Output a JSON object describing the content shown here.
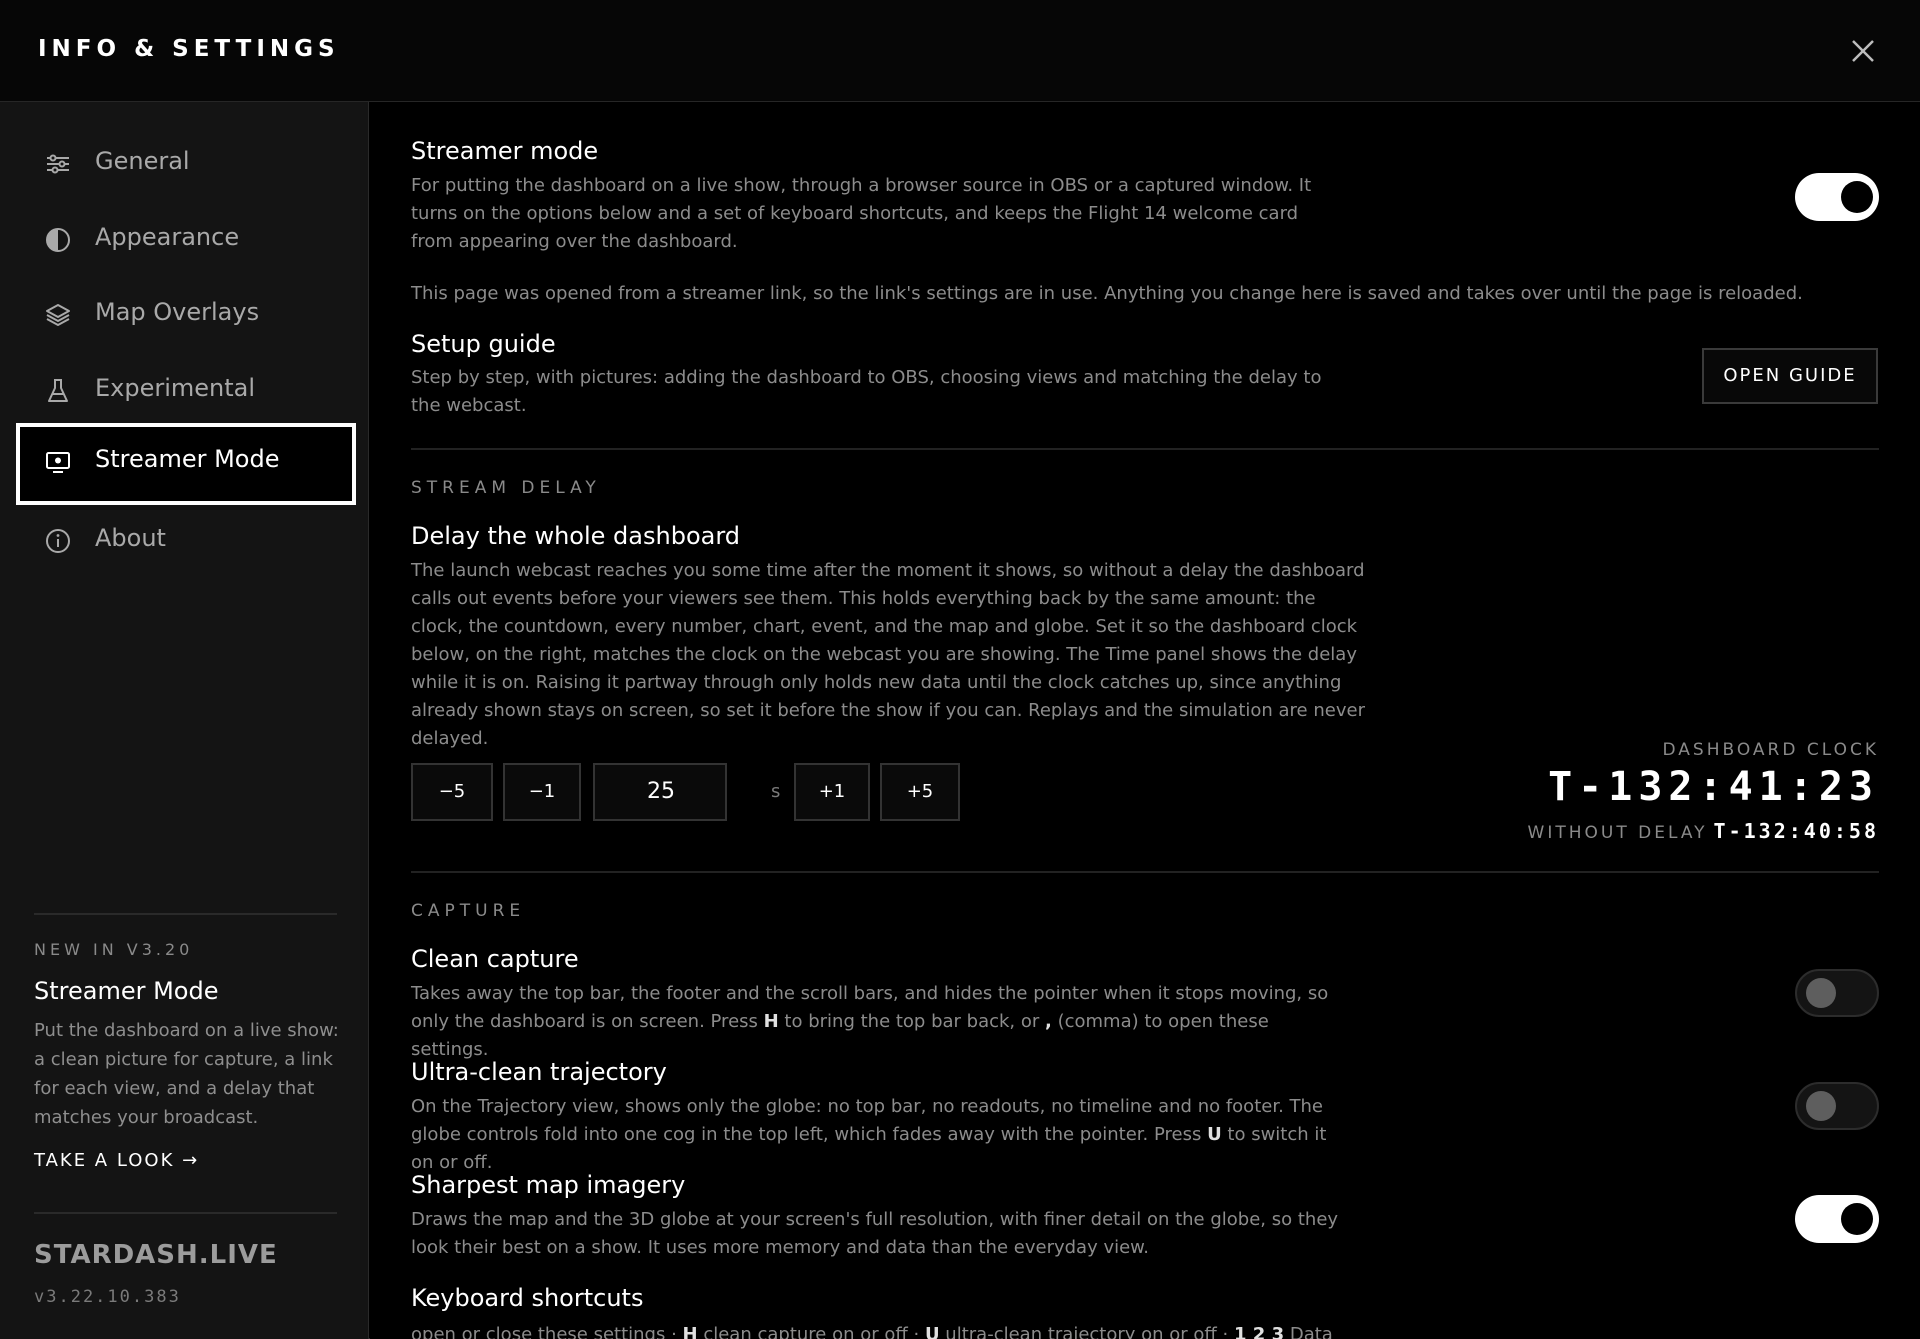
{
  "header": {
    "title": "INFO & SETTINGS"
  },
  "sidebar": {
    "items": [
      {
        "label": "General",
        "icon": "sliders-icon"
      },
      {
        "label": "Appearance",
        "icon": "contrast-icon"
      },
      {
        "label": "Map Overlays",
        "icon": "layers-icon"
      },
      {
        "label": "Experimental",
        "icon": "flask-icon"
      },
      {
        "label": "Streamer Mode",
        "icon": "monitor-icon",
        "active": true
      },
      {
        "label": "About",
        "icon": "info-icon"
      }
    ],
    "new_in": {
      "label": "NEW IN V3.20",
      "title": "Streamer Mode",
      "description": "Put the dashboard on a live show: a clean picture for capture, a link for each view, and a delay that matches your broadcast.",
      "link": "TAKE A LOOK →"
    },
    "brand": "STARDASH.LIVE",
    "version": "v3.22.10.383"
  },
  "main": {
    "streamer_mode": {
      "title": "Streamer mode",
      "description": "For putting the dashboard on a live show, through a browser source in OBS or a captured window. It turns on the options below and a set of keyboard shortcuts, and keeps the Flight 14 welcome card from appearing over the dashboard.",
      "enabled": true
    },
    "note": "This page was opened from a streamer link, so the link's settings are in use. Anything you change here is saved and takes over until the page is reloaded.",
    "setup_guide": {
      "title": "Setup guide",
      "description": "Step by step, with pictures: adding the dashboard to OBS, choosing views and matching the delay to the webcast.",
      "button": "OPEN GUIDE"
    },
    "stream_delay": {
      "section_label": "STREAM DELAY",
      "title": "Delay the whole dashboard",
      "description": "The launch webcast reaches you some time after the moment it shows, so without a delay the dashboard calls out events before your viewers see them. This holds everything back by the same amount: the clock, the countdown, every number, chart, event, and the map and globe. Set it so the dashboard clock below, on the right, matches the clock on the webcast you are showing. The Time panel shows the delay while it is on. Raising it partway through only holds new data until the clock catches up, since anything already shown stays on screen, so set it before the show if you can. Replays and the simulation are never delayed.",
      "buttons": {
        "minus5": "−5",
        "minus1": "−1",
        "plus1": "+1",
        "plus5": "+5"
      },
      "value": "25",
      "unit": "s",
      "clock_label": "DASHBOARD CLOCK",
      "clock_value": "T-132:41:23",
      "without_delay_label": "WITHOUT DELAY",
      "without_delay_value": "T-132:40:58"
    },
    "capture": {
      "section_label": "CAPTURE",
      "clean_capture": {
        "title": "Clean capture",
        "desc_part1": "Takes away the top bar, the footer and the scroll bars, and hides the pointer when it stops moving, so only the dashboard is on screen. Press ",
        "key1": "H",
        "desc_part2": " to bring the top bar back, or ",
        "key2": ",",
        "desc_part3": " (comma) to open these settings.",
        "enabled": false
      },
      "ultra_clean": {
        "title": "Ultra-clean trajectory",
        "desc_part1": "On the Trajectory view, shows only the globe: no top bar, no readouts, no timeline and no footer. The globe controls fold into one cog in the top left, which fades away with the pointer. Press ",
        "key1": "U",
        "desc_part2": " to switch it on or off.",
        "enabled": false
      },
      "sharpest_map": {
        "title": "Sharpest map imagery",
        "description": "Draws the map and the 3D globe at your screen's full resolution, with finer detail on the globe, so they look their best on a show. It uses more memory and data than the everyday view.",
        "enabled": true
      },
      "keyboard_shortcuts": {
        "title": "Keyboard shortcuts",
        "p1": " open or close these settings · ",
        "k1": "H",
        "p2": " clean capture on or off · ",
        "k2": "U",
        "p3": " ultra-clean trajectory on or off · ",
        "k3": "1 2 3",
        "p4": " Data"
      }
    }
  }
}
